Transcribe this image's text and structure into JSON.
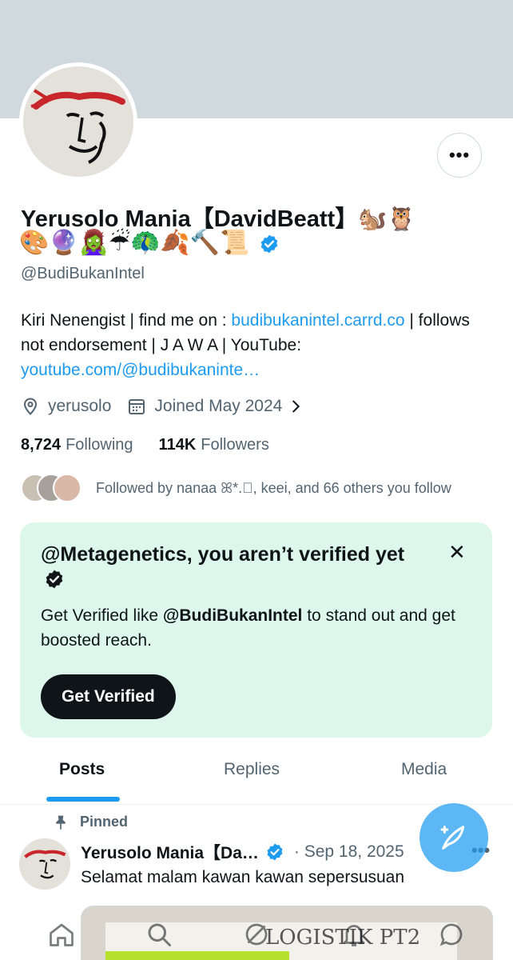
{
  "profile": {
    "name": "Yerusolo Mania【DavidBeatt】🐿️🦉",
    "emoji_line": "🎨🔮🧟‍♀️☔🦚🍂🔨📜",
    "handle": "@BudiBukanIntel",
    "bio_1": "Kiri Nenengist | find me on : ",
    "bio_link_1": "budibukanintel.carrd.co",
    "bio_2": " | follows not endorsement | J A W A | YouTube: ",
    "bio_link_2": "youtube.com/@budibukaninte…",
    "location": "yerusolo",
    "joined": "Joined May 2024",
    "following_count": "8,724",
    "following_label": "Following",
    "followers_count": "114K",
    "followers_label": "Followers",
    "followed_by": "Followed by nanaa ꕤ*.゚, keei, and 66 others you follow"
  },
  "promo": {
    "title": "@Metagenetics, you aren’t verified yet",
    "text_1": "Get Verified like ",
    "text_handle": "@BudiBukanIntel",
    "text_2": " to stand out and get boosted reach.",
    "button": "Get Verified",
    "close": "✕",
    "bg_color": "#def7ec"
  },
  "tabs": [
    {
      "label": "Posts",
      "active": true
    },
    {
      "label": "Replies",
      "active": false
    },
    {
      "label": "Media",
      "active": false
    }
  ],
  "post": {
    "pinned_label": "Pinned",
    "author": "Yerusolo Mania【Da…",
    "date": "· Sep 18, 2025",
    "text": "Selamat malam kawan kawan sepersusuan",
    "media_text": "LOGISTIK PT2"
  },
  "icons": {
    "more": "more-horizontal-icon",
    "location": "location-pin-icon",
    "calendar": "calendar-icon",
    "chevron": "chevron-right-icon",
    "verified": "verified-badge-icon",
    "pin": "pin-icon",
    "compose": "compose-icon",
    "nav": [
      "home-icon",
      "search-icon",
      "grok-icon",
      "notifications-icon",
      "messages-icon"
    ]
  },
  "colors": {
    "accent": "#1d9bf0",
    "banner": "#cfd9de",
    "text_secondary": "#536471"
  }
}
